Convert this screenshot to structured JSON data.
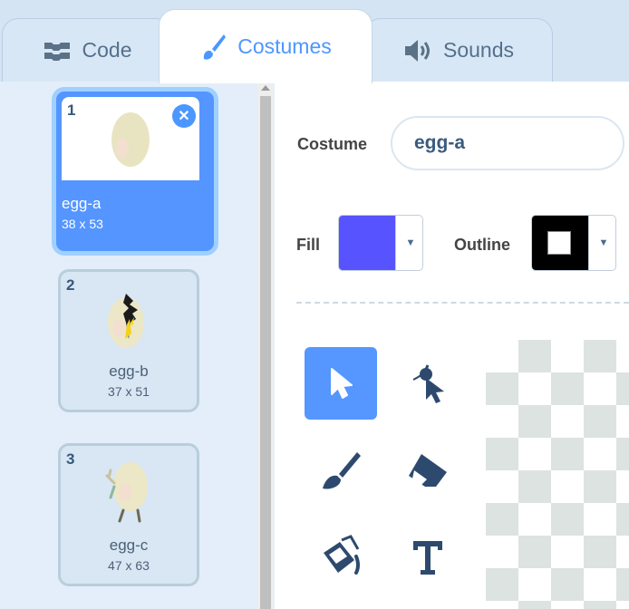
{
  "tabs": [
    {
      "label": "Code",
      "icon": "code-blocks-icon"
    },
    {
      "label": "Costumes",
      "icon": "paintbrush-icon",
      "active": true
    },
    {
      "label": "Sounds",
      "icon": "speaker-icon"
    }
  ],
  "costumes": [
    {
      "number": "1",
      "name": "egg-a",
      "size": "38 x 53",
      "selected": true
    },
    {
      "number": "2",
      "name": "egg-b",
      "size": "37 x 51"
    },
    {
      "number": "3",
      "name": "egg-c",
      "size": "47 x 63"
    }
  ],
  "editor": {
    "costume_label": "Costume",
    "costume_name": "egg-a",
    "fill_label": "Fill",
    "fill_color": "#5753ff",
    "outline_label": "Outline",
    "outline_color": "#000000"
  },
  "tools": [
    "select-tool",
    "reshape-tool",
    "brush-tool",
    "eraser-tool",
    "fill-tool",
    "text-tool"
  ],
  "colors": {
    "accent": "#4c97ff",
    "tab_bg": "#d8e7f5",
    "panel_bg": "#e3eefa"
  }
}
